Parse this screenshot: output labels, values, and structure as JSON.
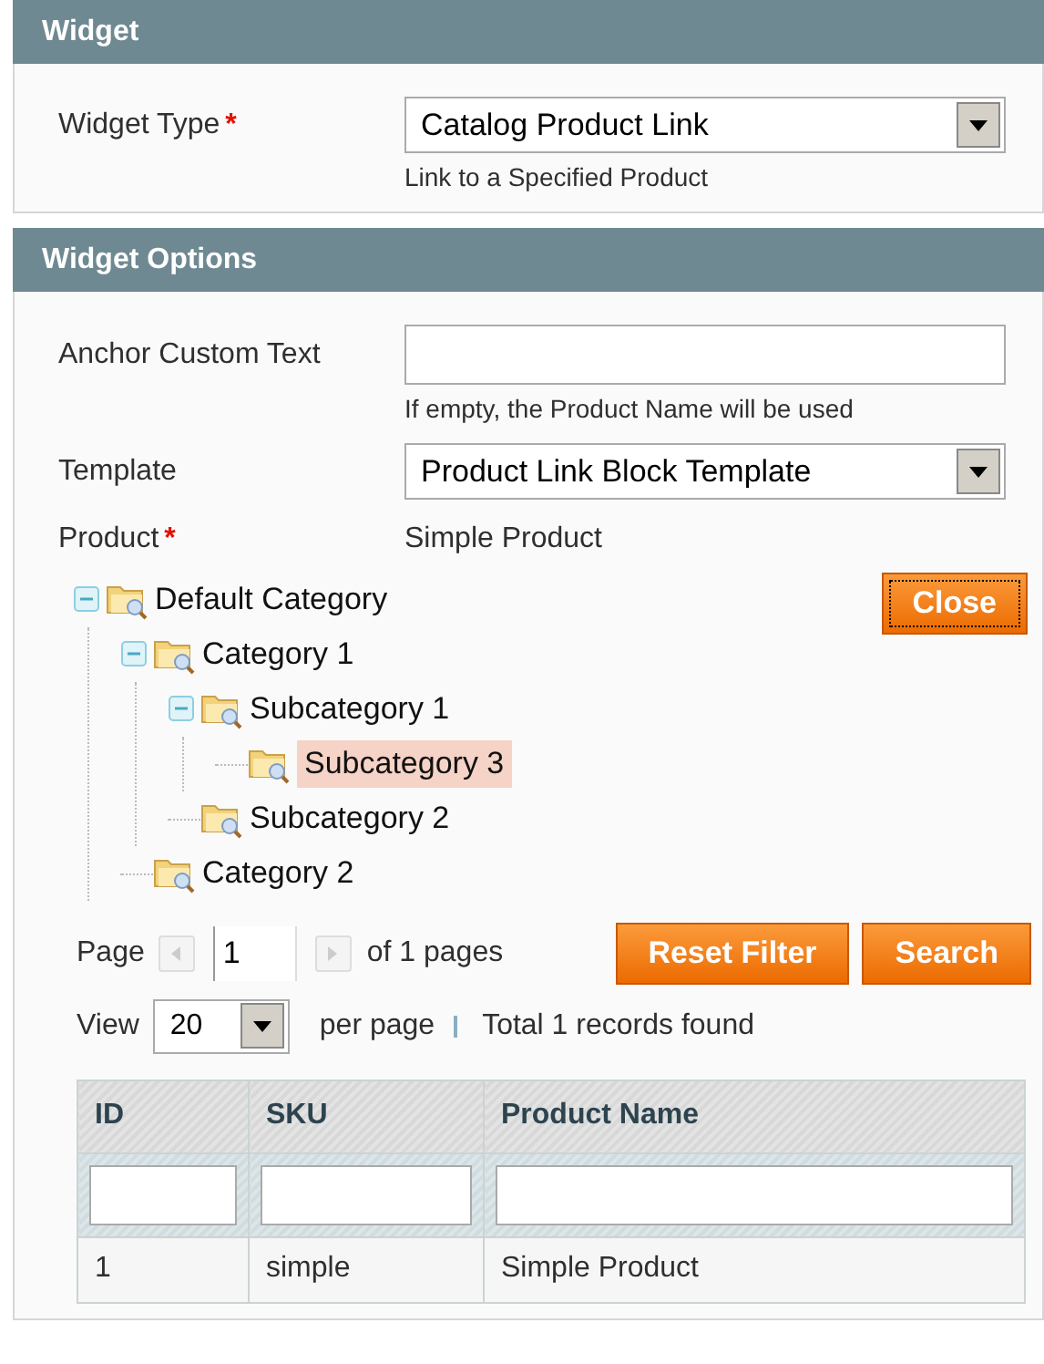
{
  "sections": [
    {
      "title": "Widget",
      "fields": [
        {
          "kind": "select",
          "label": "Widget Type",
          "required_mark": "*",
          "value": "Catalog Product Link",
          "note": "Link to a Specified Product"
        }
      ]
    },
    {
      "title": "Widget Options",
      "fields": [
        {
          "kind": "text",
          "label": "Anchor Custom Text",
          "note": "If empty, the Product Name will be used"
        },
        {
          "kind": "select",
          "label": "Template",
          "value": "Product Link Block Template"
        },
        {
          "kind": "static",
          "label": "Product",
          "required_mark": "*",
          "value": "Simple Product"
        }
      ],
      "chooser": {
        "close_button": "Close",
        "tree": [
          {
            "label": "Default Category",
            "expanded": true,
            "selected": false,
            "children": [
              {
                "label": "Category 1",
                "expanded": true,
                "selected": false,
                "children": [
                  {
                    "label": "Subcategory 1",
                    "expanded": true,
                    "selected": false,
                    "children": [
                      {
                        "label": "Subcategory 3",
                        "selected": true
                      }
                    ]
                  },
                  {
                    "label": "Subcategory 2",
                    "selected": false
                  }
                ]
              },
              {
                "label": "Category 2",
                "selected": false
              }
            ]
          }
        ],
        "pager": {
          "label": "Page",
          "page": "1",
          "of_pages": "of 1 pages",
          "view_label": "View",
          "per_page": "20",
          "per_page_label": "per page",
          "total": "Total 1 records found"
        },
        "buttons": [
          "Reset Filter",
          "Search"
        ],
        "table": {
          "columns": [
            "ID",
            "SKU",
            "Product Name"
          ],
          "rows": [
            [
              "1",
              "simple",
              "Simple Product"
            ]
          ]
        }
      }
    }
  ]
}
